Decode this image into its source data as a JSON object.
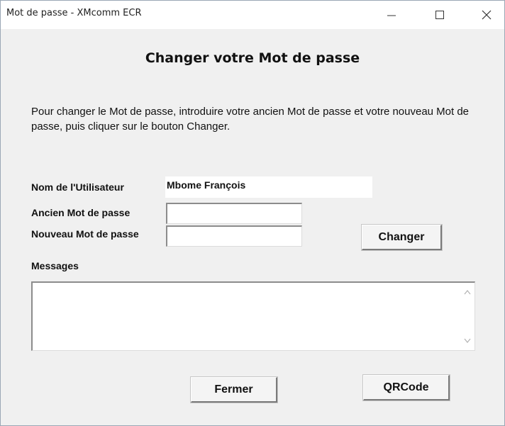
{
  "window": {
    "title": "Mot de passe - XMcomm ECR",
    "controls": {
      "minimize": "minimize-icon",
      "maximize": "maximize-icon",
      "close": "close-icon"
    }
  },
  "dialog": {
    "heading": "Changer votre Mot de passe",
    "instructions": "Pour changer le Mot de passe, introduire votre ancien Mot de passe et votre nouveau Mot de passe, puis cliquer sur le bouton Changer."
  },
  "form": {
    "username_label": "Nom de l'Utilisateur",
    "username_value": "Mbome François",
    "old_password_label": "Ancien Mot de passe",
    "old_password_value": "",
    "new_password_label": "Nouveau Mot de passe",
    "new_password_value": "",
    "messages_label": "Messages",
    "messages_value": ""
  },
  "buttons": {
    "change": "Changer",
    "close": "Fermer",
    "qrcode": "QRCode"
  }
}
